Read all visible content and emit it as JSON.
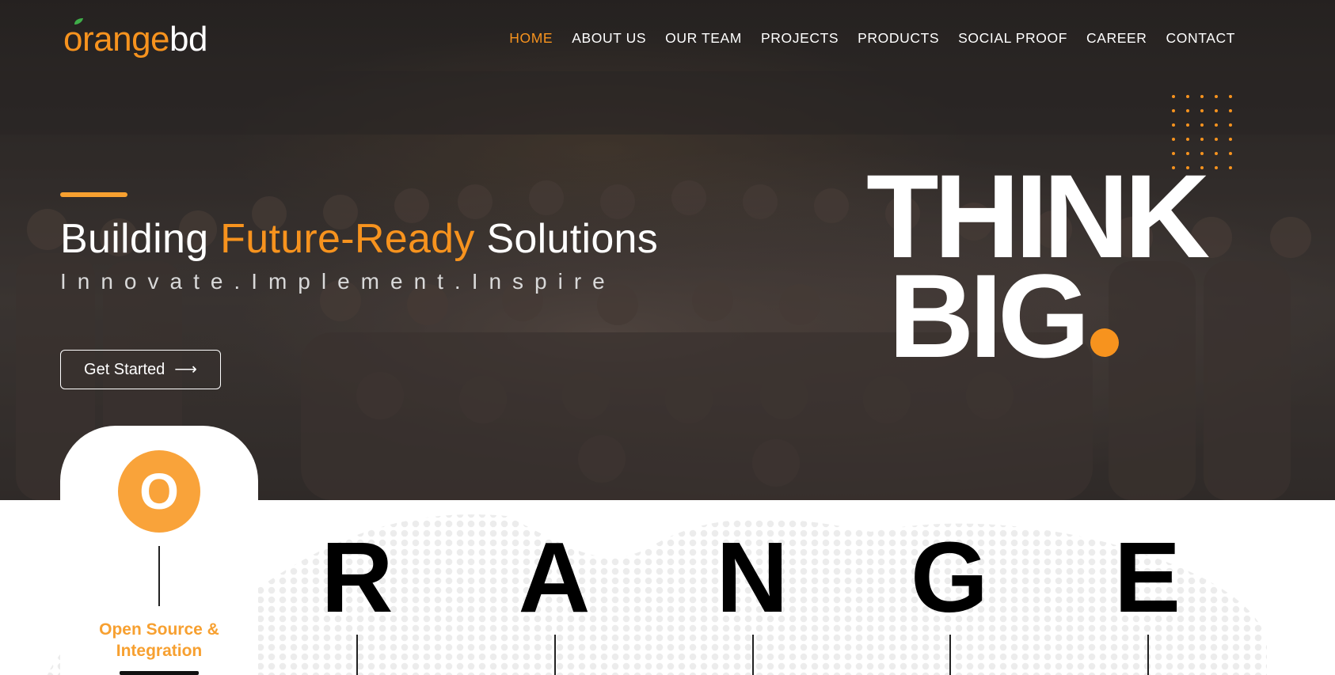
{
  "brand": {
    "logo_orange": "orange",
    "logo_suffix": "bd"
  },
  "nav": {
    "items": [
      "HOME",
      "ABOUT US",
      "OUR TEAM",
      "PROJECTS",
      "PRODUCTS",
      "SOCIAL PROOF",
      "CAREER",
      "CONTACT"
    ],
    "active": "HOME"
  },
  "hero": {
    "headline_pre": "Building ",
    "headline_highlight": "Future-Ready",
    "headline_post": " Solutions",
    "tagline": "Innovate.Implement.Inspire",
    "cta_label": "Get Started",
    "think_line1": "THINK",
    "think_line2": "BIG"
  },
  "orange_section": {
    "o_letter": "O",
    "o_label_line1": "Open Source &",
    "o_label_line2": "Integration",
    "letters": [
      "R",
      "A",
      "N",
      "G",
      "E"
    ]
  },
  "colors": {
    "accent": "#f7931e",
    "accent_light": "#f9a33a",
    "hero_bg": "#2a2624"
  },
  "icons": {
    "cta_icon": "arrow-right-icon",
    "logo_leaf": "leaf-icon"
  }
}
